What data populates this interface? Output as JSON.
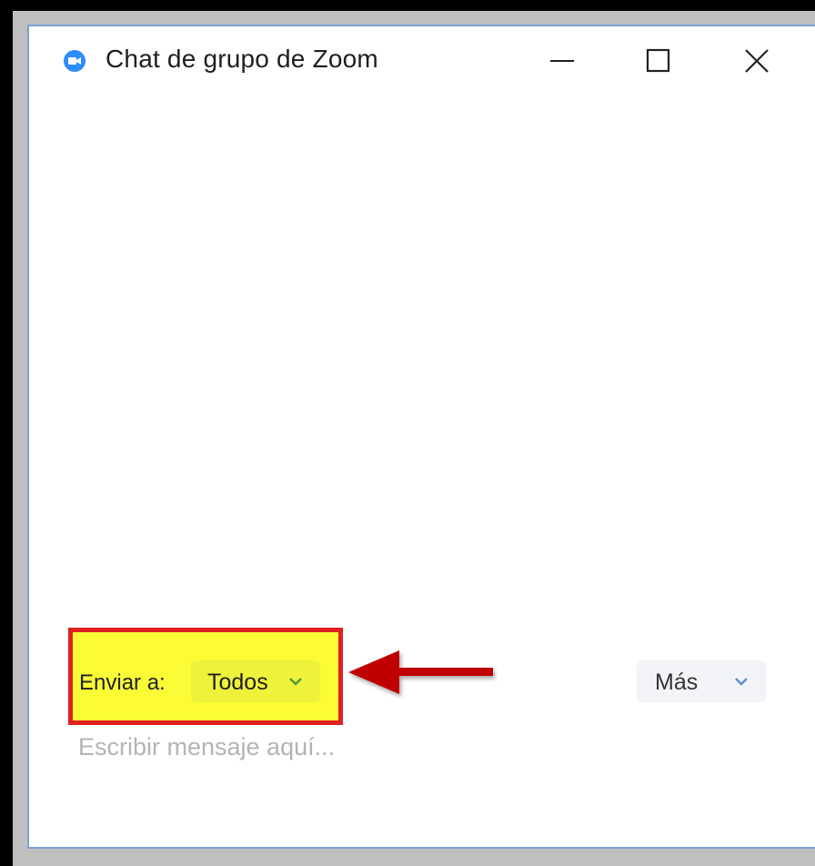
{
  "window": {
    "title": "Chat de grupo de Zoom",
    "controls": {
      "minimize": "minimize-icon",
      "maximize": "maximize-icon",
      "close": "close-icon"
    }
  },
  "composer": {
    "send_to_label": "Enviar a:",
    "recipient": "Todos",
    "more_label": "Más",
    "placeholder": "Escribir mensaje aquí..."
  },
  "annotation": {
    "highlight_color": "#fbfb36",
    "border_color": "#e02020",
    "arrow_color": "#c00000"
  },
  "colors": {
    "zoom_blue": "#2d8cff",
    "window_border": "#7aa3d6"
  }
}
